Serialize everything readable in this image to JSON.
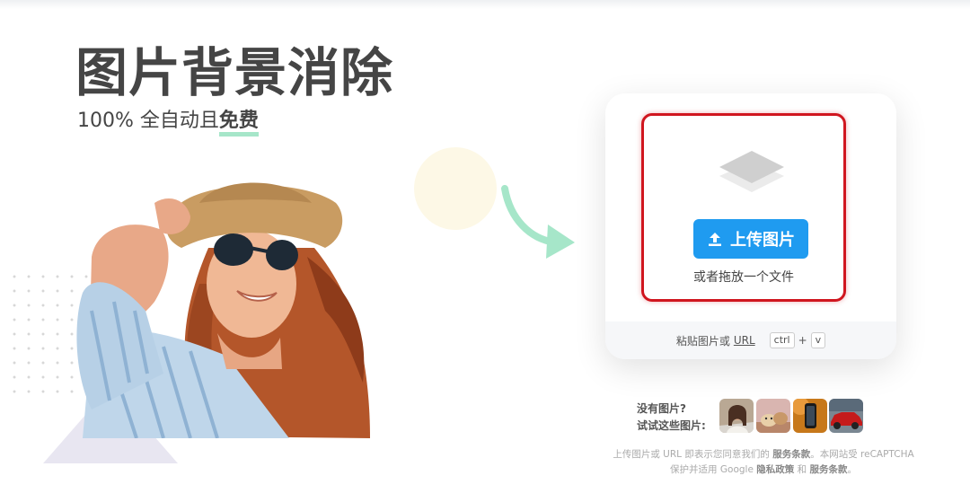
{
  "hero": {
    "title": "图片背景消除",
    "subtitle_prefix": "100% 全自动且",
    "subtitle_highlight": "免费"
  },
  "upload": {
    "button_label": "上传图片",
    "drop_text": "或者拖放一个文件",
    "paste_prefix": "粘贴图片或",
    "paste_url": "URL",
    "key_ctrl": "ctrl",
    "key_plus": "+",
    "key_v": "v"
  },
  "samples": {
    "line1": "没有图片?",
    "line2": "试试这些图片:",
    "items": [
      "woman-portrait",
      "dog-and-cat",
      "smartphone",
      "red-car"
    ]
  },
  "legal": {
    "part1": "上传图片或 URL 即表示您同意我们的",
    "terms1": "服务条款",
    "part2": "。本网站受 reCAPTCHA",
    "part3": "保护并适用 Google",
    "privacy": "隐私政策",
    "part4": "和",
    "terms2": "服务条款",
    "part5": "。"
  },
  "colors": {
    "accent_blue": "#1f9bf0",
    "highlight_red": "#d0161f",
    "arrow_green": "#a6e6c9"
  }
}
